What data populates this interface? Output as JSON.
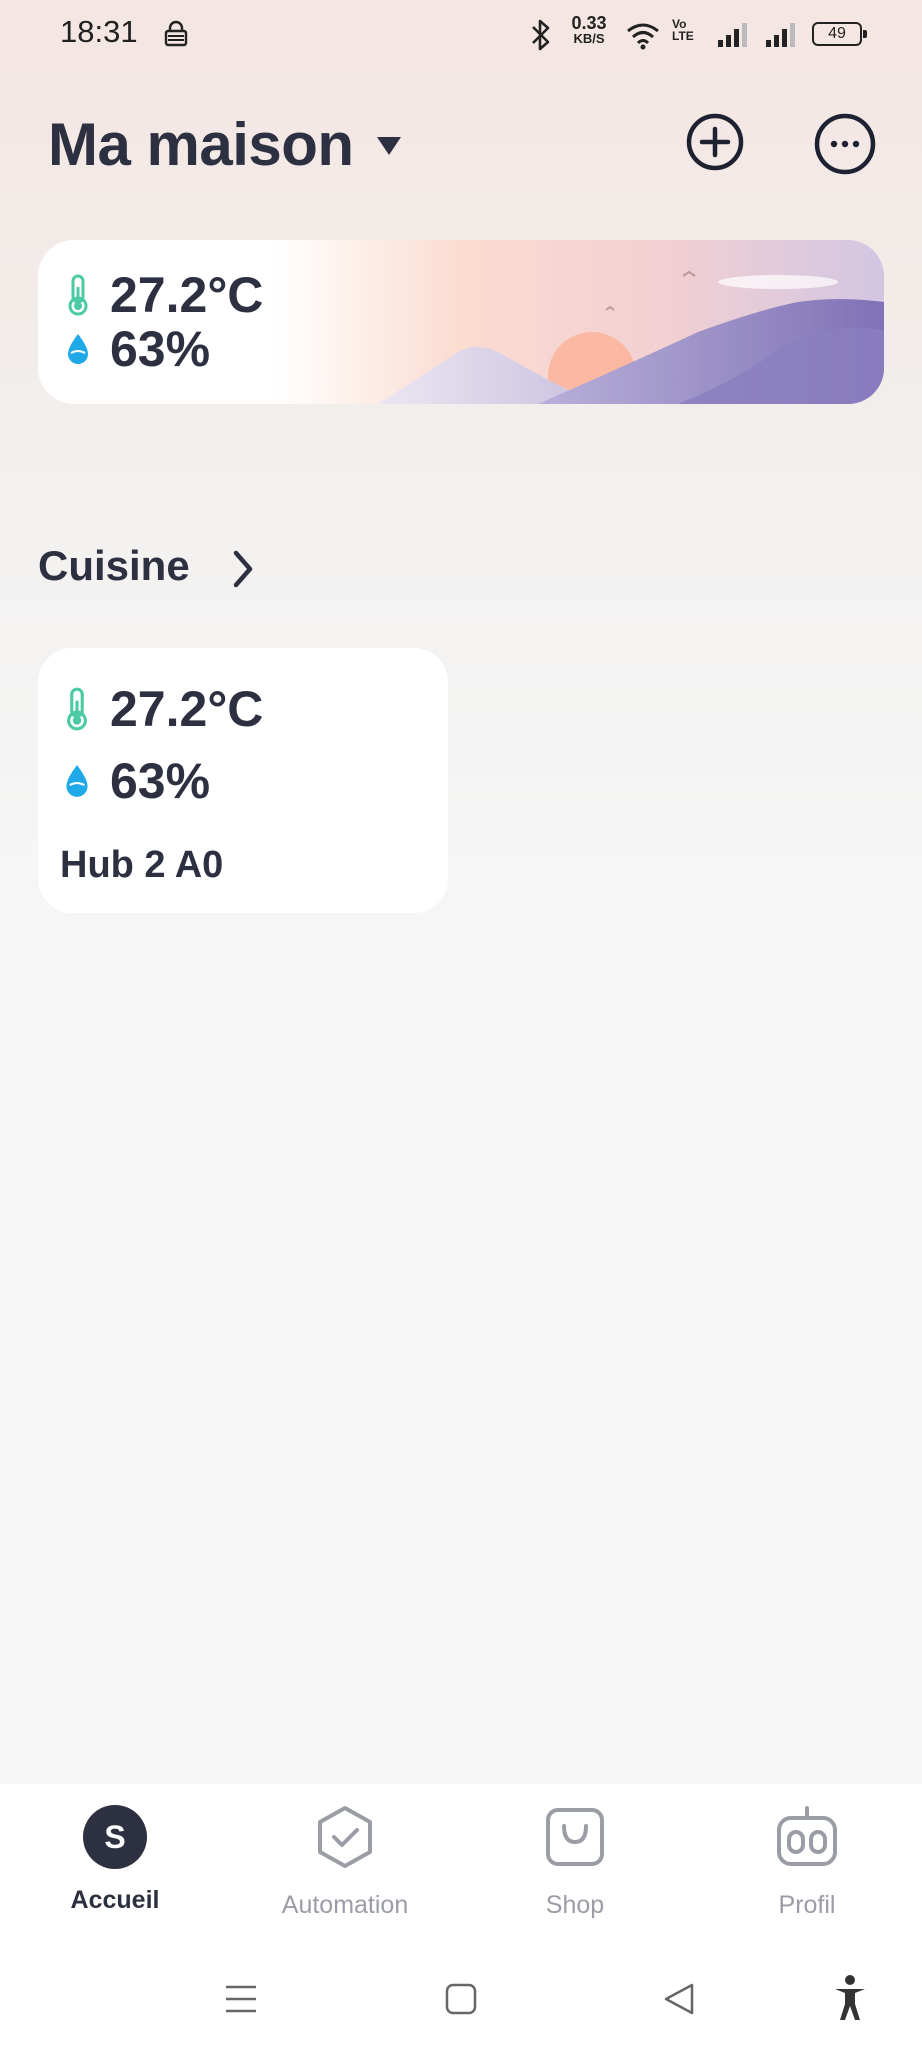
{
  "status_bar": {
    "time": "18:31",
    "net_speed_value": "0.33",
    "net_speed_unit": "KB/S",
    "volte": "Vo LTE",
    "battery": "49"
  },
  "header": {
    "home_name": "Ma maison"
  },
  "weather": {
    "temperature": "27.2°C",
    "humidity": "63%"
  },
  "room": {
    "name": "Cuisine"
  },
  "device": {
    "temperature": "27.2°C",
    "humidity": "63%",
    "name": "Hub 2 A0"
  },
  "bottom_nav": {
    "items": [
      {
        "label": "Accueil",
        "icon": "avatar-icon",
        "avatar_letter": "S",
        "active": true
      },
      {
        "label": "Automation",
        "icon": "automation-icon",
        "active": false
      },
      {
        "label": "Shop",
        "icon": "shop-bag-icon",
        "active": false
      },
      {
        "label": "Profil",
        "icon": "robot-icon",
        "active": false
      }
    ]
  },
  "colors": {
    "accent_dark": "#2d3040",
    "thermo_green": "#4ccaa3",
    "humidity_blue": "#1fa9e8",
    "inactive": "#9a9da5"
  }
}
